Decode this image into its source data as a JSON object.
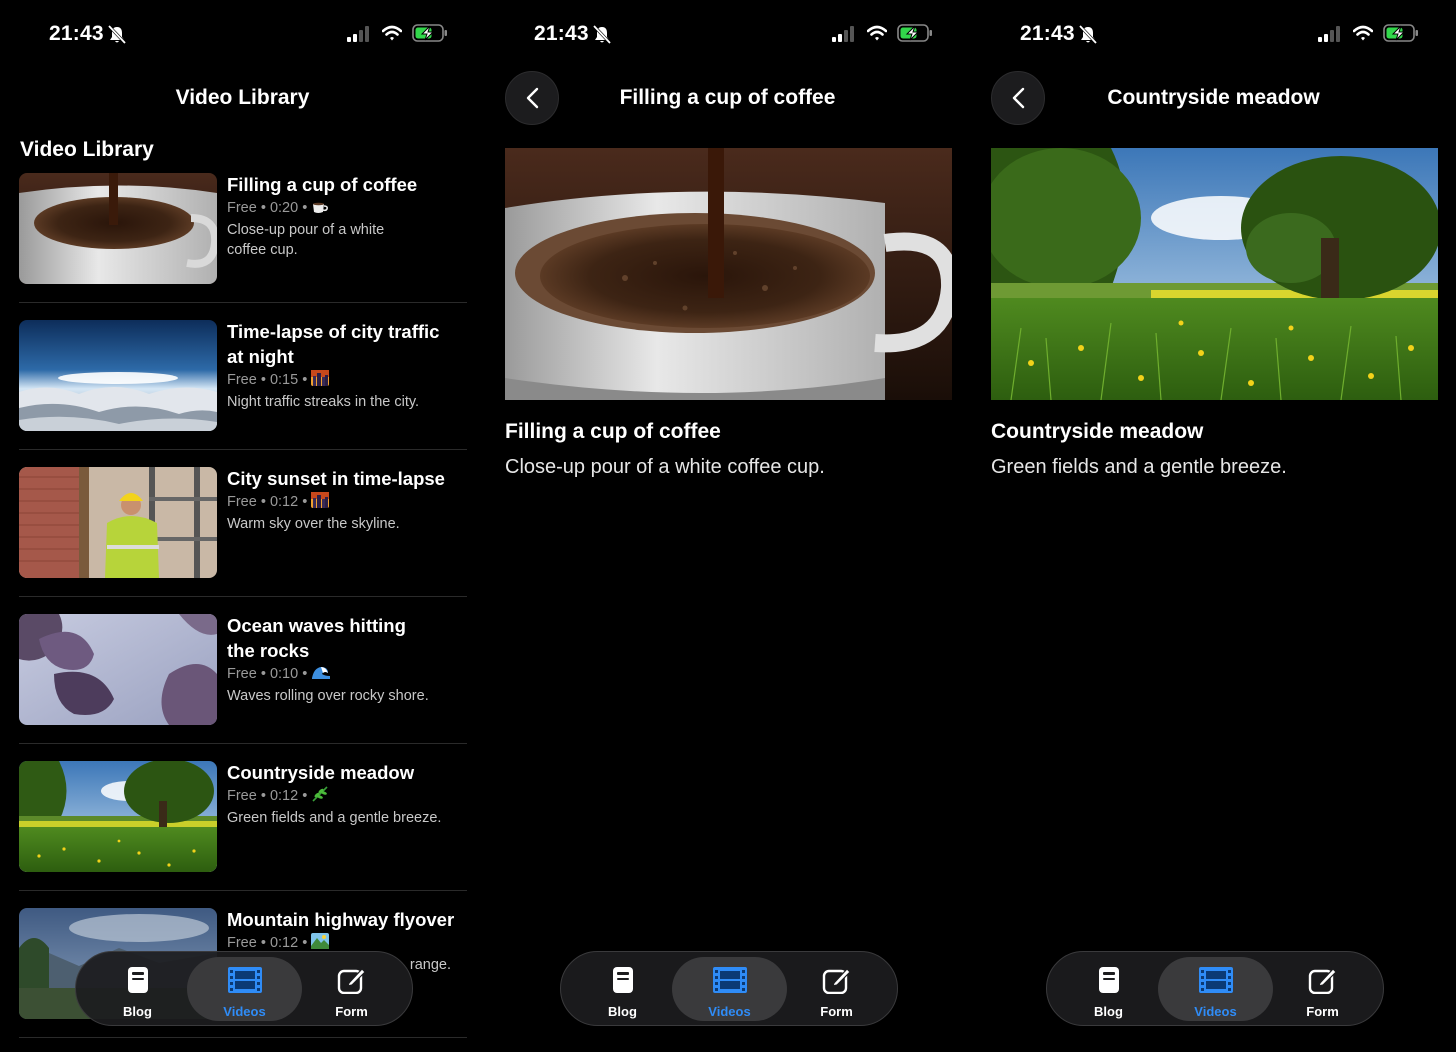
{
  "status_bar": {
    "time": "21:43"
  },
  "library": {
    "nav_title": "Video Library",
    "section_title": "Video Library",
    "videos": [
      {
        "title": "Filling a cup of coffee",
        "meta": "Free • 0:20 •",
        "emoji": "coffee-icon",
        "description": "Close-up pour of a white coffee cup."
      },
      {
        "title": "Time-lapse of city traffic at night",
        "meta": "Free • 0:15 •",
        "emoji": "city-sunset-icon",
        "description": "Night traffic streaks in the city."
      },
      {
        "title": "City sunset in time-lapse",
        "meta": "Free • 0:12 •",
        "emoji": "city-sunset-icon",
        "description": "Warm sky over the skyline."
      },
      {
        "title": "Ocean waves hitting the rocks",
        "meta": "Free • 0:10 •",
        "emoji": "wave-icon",
        "description": "Waves rolling over rocky shore."
      },
      {
        "title": "Countryside meadow",
        "meta": "Free • 0:12 •",
        "emoji": "herb-icon",
        "description": "Green fields and a gentle breeze."
      },
      {
        "title": "Mountain highway flyover",
        "meta": "Free • 0:12 •",
        "emoji": "landscape-icon",
        "description": "range."
      }
    ]
  },
  "detail_coffee": {
    "nav_title": "Filling a cup of coffee",
    "title": "Filling a cup of coffee",
    "description": "Close-up pour of a white coffee cup."
  },
  "detail_meadow": {
    "nav_title": "Countryside meadow",
    "title": "Countryside meadow",
    "description": "Green fields and a gentle breeze."
  },
  "tab_bar": {
    "tabs": [
      {
        "label": "Blog",
        "icon": "blog-icon"
      },
      {
        "label": "Videos",
        "icon": "film-icon",
        "active": true
      },
      {
        "label": "Form",
        "icon": "compose-icon"
      }
    ],
    "active_color": "#2f8cf7"
  }
}
